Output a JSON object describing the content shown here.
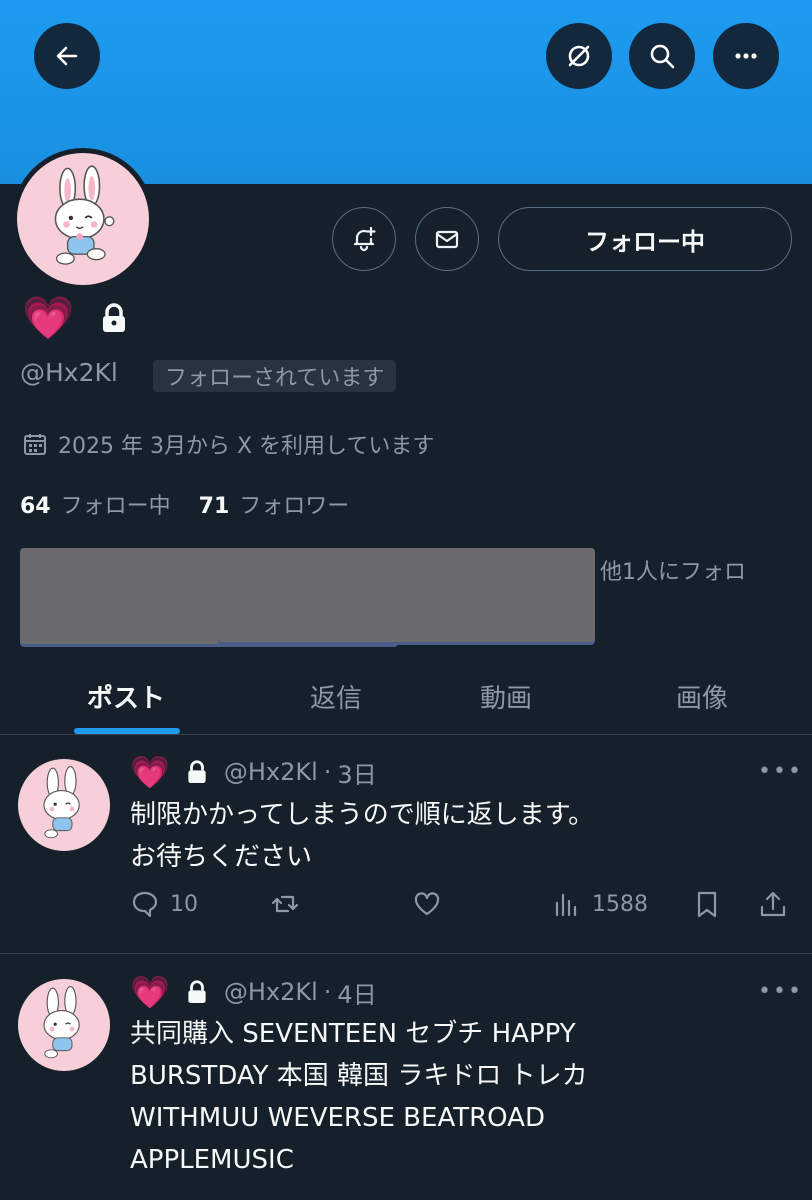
{
  "header": {
    "back_icon": "arrow-left-icon",
    "grok_icon": "grok-icon",
    "search_icon": "search-icon",
    "more_icon": "more-icon"
  },
  "profile": {
    "avatar": "bunny-character-avatar",
    "display_name_emoji": "💗",
    "protected_icon": "lock-icon",
    "handle": "@Hx2Kl",
    "follows_you": "フォローされています",
    "joined": "2025 年 3月から X を利用しています",
    "following_count": "64",
    "following_label": "フォロー中",
    "followers_count": "71",
    "followers_label": "フォロワー",
    "followed_by_text": "他1人にフォロ",
    "follow_button": "フォロー中"
  },
  "tabs": [
    "ポスト",
    "返信",
    "動画",
    "画像"
  ],
  "posts": [
    {
      "name_emoji": "💗",
      "handle": "@Hx2Kl",
      "dot": "·",
      "time": "3日",
      "text": "制限かかってしまうので順に返します。\nお待ちください",
      "replies": "10",
      "reposts": "",
      "likes": "",
      "views": "1588"
    },
    {
      "name_emoji": "💗",
      "handle": "@Hx2Kl",
      "dot": "·",
      "time": "4日",
      "text": "共同購入 SEVENTEEN セブチ HAPPY\nBURSTDAY 本国 韓国 ラキドロ トレカ\nWITHMUU WEVERSE BEATROAD\nAPPLEMUSIC"
    }
  ],
  "colors": {
    "banner": "#1d9bf0",
    "background": "#15202b",
    "accent": "#1d9bf0",
    "heart": "#ff2fae"
  }
}
